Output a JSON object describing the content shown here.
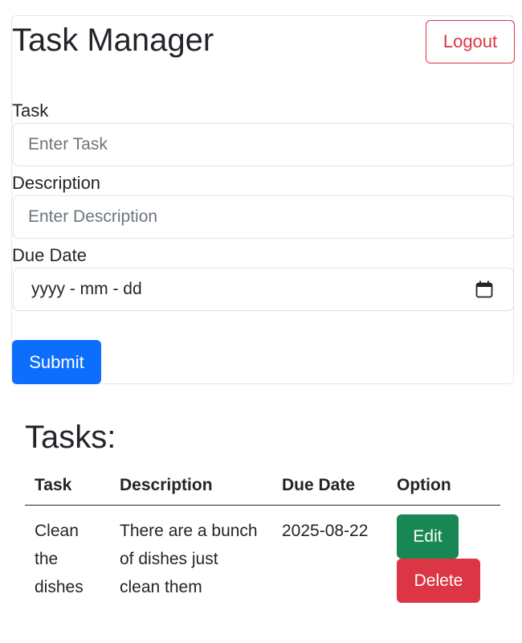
{
  "header": {
    "title": "Task Manager",
    "logout_label": "Logout"
  },
  "form": {
    "task_label": "Task",
    "task_placeholder": "Enter Task",
    "description_label": "Description",
    "description_placeholder": "Enter Description",
    "due_date_label": "Due Date",
    "due_date_value": "yyyy - mm - dd",
    "due_date_icon": "calendar-icon",
    "submit_label": "Submit"
  },
  "tasks": {
    "heading": "Tasks:",
    "columns": [
      "Task",
      "Description",
      "Due Date",
      "Option"
    ],
    "rows": [
      {
        "task": "Clean the dishes",
        "description": "There are a bunch of dishes just clean them",
        "due_date": "2025-08-22",
        "edit_label": "Edit",
        "delete_label": "Delete"
      }
    ]
  },
  "colors": {
    "primary": "#0d6efd",
    "success": "#198754",
    "danger": "#dc3545"
  }
}
